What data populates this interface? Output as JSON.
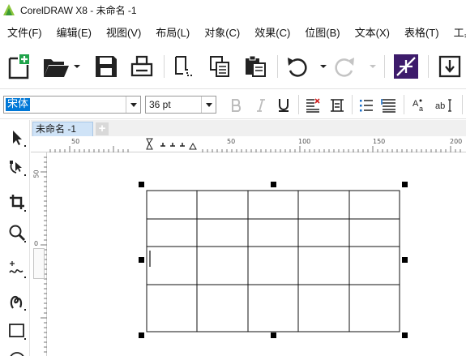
{
  "window": {
    "title": "CorelDRAW X8 - 未命名 -1",
    "app_icon": "coreldraw-logo-icon"
  },
  "menu": [
    {
      "label": "文件(F)"
    },
    {
      "label": "编辑(E)"
    },
    {
      "label": "视图(V)"
    },
    {
      "label": "布局(L)"
    },
    {
      "label": "对象(C)"
    },
    {
      "label": "效果(C)"
    },
    {
      "label": "位图(B)"
    },
    {
      "label": "文本(X)"
    },
    {
      "label": "表格(T)"
    },
    {
      "label": "工具"
    }
  ],
  "standard_toolbar": {
    "icons": [
      "new-document-icon",
      "open-folder-icon",
      "save-icon",
      "print-icon",
      "cut-icon",
      "copy-icon",
      "paste-icon",
      "undo-icon",
      "redo-icon",
      "import-icon",
      "export-icon"
    ]
  },
  "property_bar": {
    "font_family": "宋体",
    "font_size": "36 pt",
    "format_icons": [
      "bold-icon",
      "italic-icon",
      "underline-icon",
      "align-text-icon",
      "character-format-icon",
      "bullet-list-icon",
      "paragraph-format-icon",
      "edit-text-icon",
      "text-frame-icon"
    ]
  },
  "toolbox": {
    "tools": [
      "pick-tool-icon",
      "shape-tool-icon",
      "crop-tool-icon",
      "zoom-tool-icon",
      "freehand-tool-icon",
      "artistic-media-tool-icon",
      "rectangle-tool-icon",
      "ellipse-tool-icon"
    ]
  },
  "document_tab": {
    "label": "未命名 -1",
    "add_label": "+"
  },
  "rulers": {
    "horizontal_labels": [
      "50",
      "50",
      "100",
      "150",
      "200"
    ],
    "vertical_labels": [
      "50",
      "0"
    ]
  },
  "table": {
    "rows": 4,
    "columns": 5,
    "selected": true,
    "text_cursor_cell": [
      2,
      0
    ]
  },
  "colors": {
    "accent": "#0078d7",
    "tab_active": "#cfe3f7",
    "effects_icon_bg": "#3d1b6b"
  }
}
